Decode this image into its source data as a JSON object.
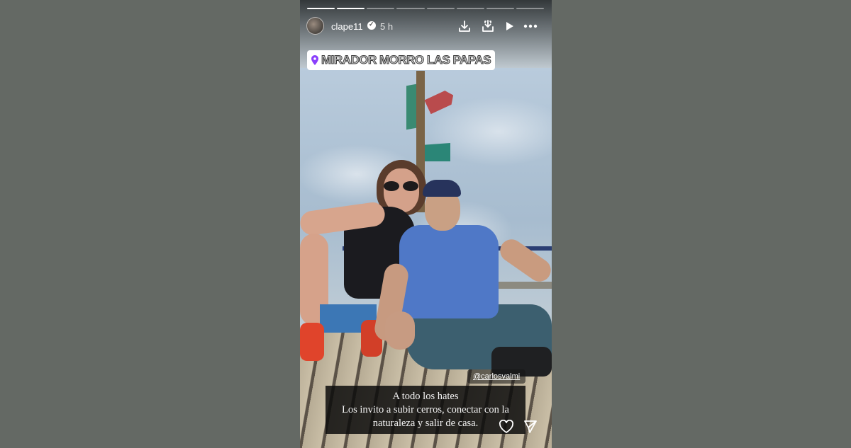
{
  "story": {
    "progress_total": 8,
    "progress_done": 2,
    "header": {
      "username": "clape11",
      "time": "5 h",
      "icons": [
        "download-icon",
        "save-to-collection-icon",
        "play-icon",
        "more-options-icon"
      ]
    },
    "location_sticker": "MIRADOR MORRO LAS PAPAS",
    "mention": "@carlosvalmi",
    "caption_lines": [
      "A todo los hates",
      "Los invito a subir cerros, conectar con la",
      "naturaleza y salir de casa."
    ],
    "footer_icons": [
      "heart-icon",
      "send-icon"
    ],
    "colors": {
      "background": "#646964",
      "location_pin": "#8a3ffc",
      "caption_bg": "#0c0c0c"
    }
  }
}
